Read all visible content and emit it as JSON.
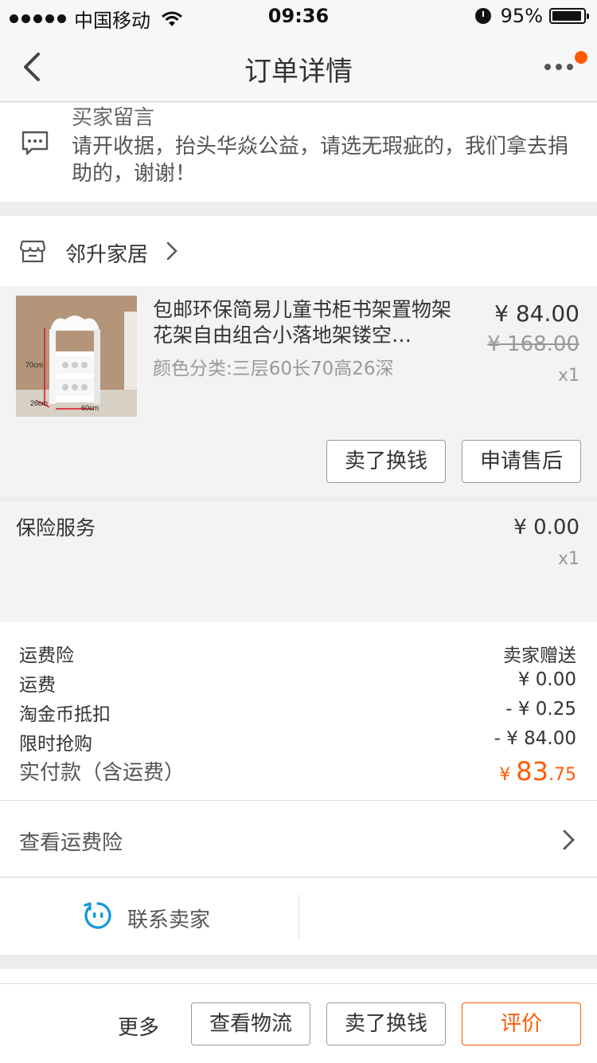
{
  "status_bar": {
    "carrier": "中国移动",
    "time": "09:36",
    "battery_percent": "95%",
    "battery_level": 0.95,
    "icons": [
      "signal-dots-icon",
      "wifi-icon",
      "alarm-icon",
      "battery-icon"
    ]
  },
  "nav": {
    "title": "订单详情",
    "icons": [
      "back-icon",
      "more-icon"
    ],
    "badge_color": "#ff5a00"
  },
  "buyer_message": {
    "title": "买家留言",
    "text": "请开收据，抬头华焱公益，请选无瑕疵的，我们拿去捐助的，谢谢！",
    "icon": "message-icon"
  },
  "shop": {
    "name": "邻升家居",
    "icon": "store-icon"
  },
  "item": {
    "title": "包邮环保简易儿童书柜书架置物架花架自由组合小落地架镂空…",
    "sku": "颜色分类:三层60长70高26深",
    "price": "¥ 84.00",
    "original_price": "¥ 168.00",
    "quantity": "x1",
    "image_labels": [
      "70cm",
      "26cm",
      "60cm"
    ],
    "buttons": {
      "sell": "卖了换钱",
      "after_sale": "申请售后"
    }
  },
  "insurance": {
    "title": "保险服务",
    "price": "¥ 0.00",
    "quantity": "x1"
  },
  "summary": {
    "rows": [
      {
        "label": "运费险",
        "value": "卖家赠送"
      },
      {
        "label": "运费",
        "value": "¥ 0.00"
      },
      {
        "label": "淘金币抵扣",
        "value": "- ¥ 0.25"
      },
      {
        "label": "限时抢购",
        "value": "- ¥ 84.00"
      }
    ],
    "total": {
      "label": "实付款（含运费）",
      "currency": "¥",
      "integer": "83",
      "decimal": ".75"
    },
    "accent_color": "#ff5a00"
  },
  "view_insurance": {
    "label": "查看运费险"
  },
  "contact": {
    "label": "联系卖家",
    "icon": "contact-seller-icon",
    "icon_color": "#1296db"
  },
  "bottom_bar": {
    "more": "更多",
    "logistics": "查看物流",
    "sell": "卖了换钱",
    "rate": "评价"
  }
}
